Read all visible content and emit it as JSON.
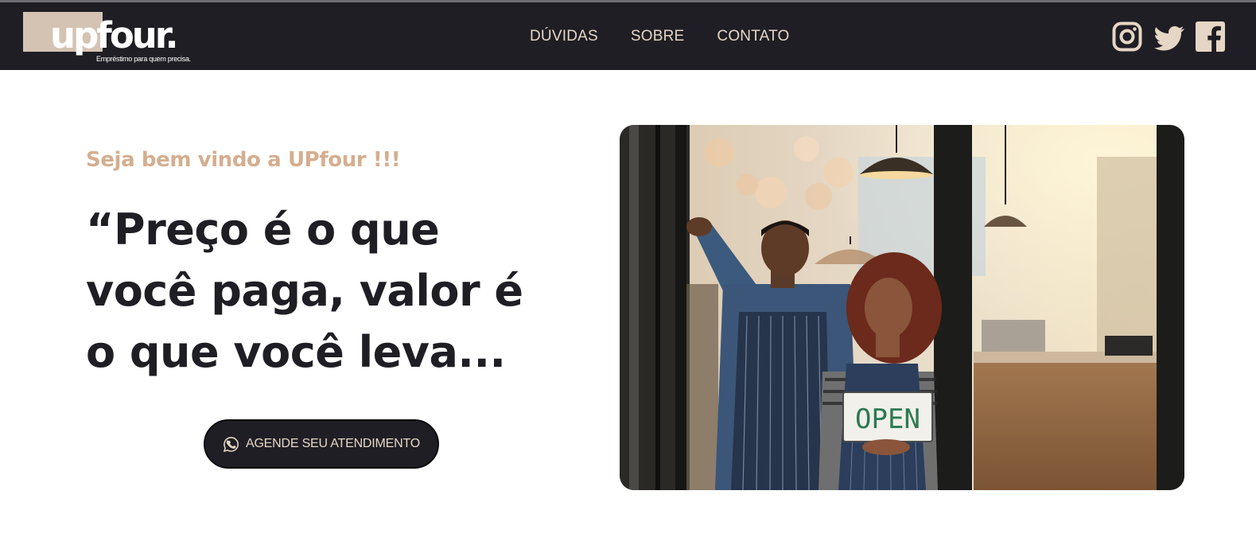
{
  "brand": {
    "name": "upfour.",
    "tagline": "Empréstimo para quem precisa."
  },
  "nav": {
    "items": [
      {
        "label": "DÚVIDAS"
      },
      {
        "label": "SOBRE"
      },
      {
        "label": "CONTATO"
      }
    ]
  },
  "social": {
    "icons": [
      "instagram-icon",
      "twitter-icon",
      "facebook-icon"
    ]
  },
  "hero": {
    "welcome": "Seja bem vindo a UPfour !!!",
    "quote": "“Preço é o que você paga, valor é o que você leva...",
    "cta_label": "AGENDE SEU ATENDIMENTO",
    "cta_icon": "whatsapp-icon",
    "image_sign_text": "OPEN"
  },
  "colors": {
    "header_bg": "#1f1e24",
    "accent": "#d5ae8f",
    "nav_text": "#e6d6c5",
    "logo_box": "#d4c3b3"
  }
}
